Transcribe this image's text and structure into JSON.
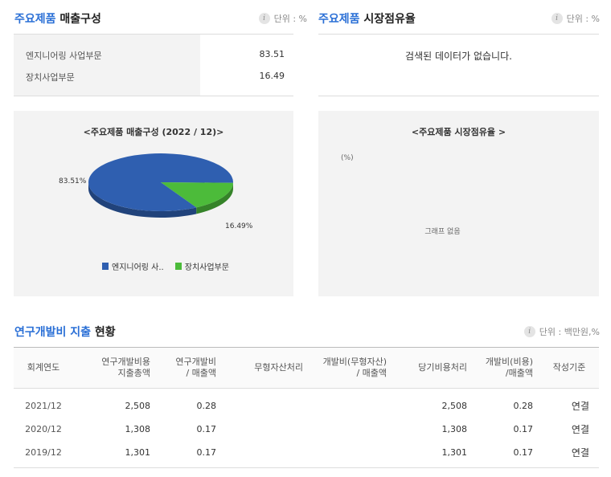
{
  "product_sales": {
    "title_highlight": "주요제품",
    "title_rest": "매출구성",
    "unit": "단위 : %",
    "rows": [
      {
        "label": "엔지니어링 사업부문",
        "value": "83.51"
      },
      {
        "label": "장치사업부문",
        "value": "16.49"
      }
    ],
    "chart": {
      "title": "<주요제품 매출구성 (2022 / 12)>",
      "legend": [
        "엔지니어링 사..",
        "장치사업부문"
      ]
    }
  },
  "market_share": {
    "title_highlight": "주요제품",
    "title_rest": "시장점유율",
    "unit": "단위 : %",
    "empty_text": "검색된 데이터가 없습니다.",
    "chart": {
      "title": "<주요제품 시장점유율 >",
      "unit_label": "(%)",
      "empty_text": "그래프 없음"
    }
  },
  "rnd": {
    "title_highlight": "연구개발비 지출",
    "title_rest": "현황",
    "unit": "단위 : 백만원,%",
    "headers": [
      {
        "line1": "회계연도",
        "line2": ""
      },
      {
        "line1": "연구개발비용",
        "line2": "지출총액"
      },
      {
        "line1": "연구개발비",
        "line2": "/ 매출액"
      },
      {
        "line1": "무형자산처리",
        "line2": ""
      },
      {
        "line1": "개발비(무형자산)",
        "line2": "/ 매출액"
      },
      {
        "line1": "당기비용처리",
        "line2": ""
      },
      {
        "line1": "개발비(비용)",
        "line2": "/매출액"
      },
      {
        "line1": "작성기준",
        "line2": ""
      }
    ],
    "rows": [
      [
        "2021/12",
        "2,508",
        "0.28",
        "",
        "",
        "2,508",
        "0.28",
        "연결"
      ],
      [
        "2020/12",
        "1,308",
        "0.17",
        "",
        "",
        "1,308",
        "0.17",
        "연결"
      ],
      [
        "2019/12",
        "1,301",
        "0.17",
        "",
        "",
        "1,301",
        "0.17",
        "연결"
      ]
    ]
  },
  "chart_data": {
    "type": "pie",
    "title": "<주요제품 매출구성 (2022 / 12)>",
    "categories": [
      "엔지니어링 사업부문",
      "장치사업부문"
    ],
    "values": [
      83.51,
      16.49
    ],
    "data_labels": [
      "83.51%",
      "16.49%"
    ],
    "legend_labels": [
      "엔지니어링 사..",
      "장치사업부문"
    ],
    "colors": [
      "#2f5fb0",
      "#4cbb3a"
    ],
    "legend_position": "bottom"
  }
}
